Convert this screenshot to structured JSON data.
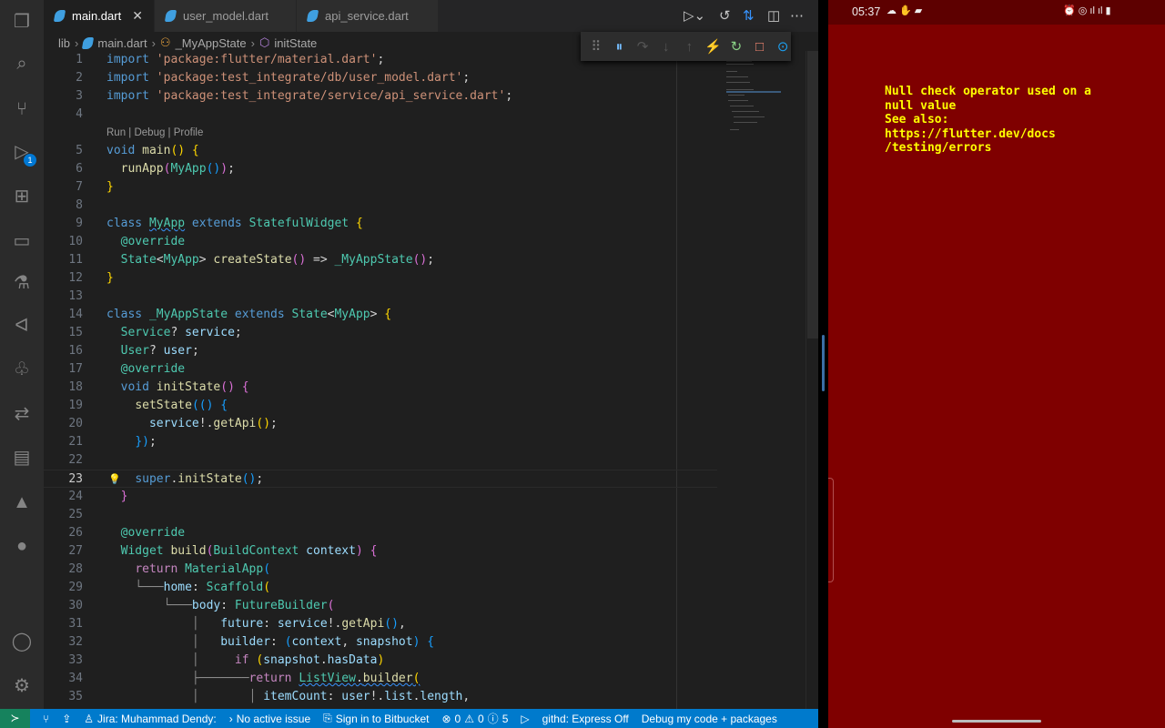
{
  "tabs": [
    {
      "label": "main.dart",
      "active": true
    },
    {
      "label": "user_model.dart"
    },
    {
      "label": "api_service.dart"
    }
  ],
  "breadcrumb": [
    "lib",
    "main.dart",
    "_MyAppState",
    "initState"
  ],
  "activity_badge": "1",
  "codelens": "Run | Debug | Profile",
  "current_line": 23,
  "code": [
    [
      1,
      [
        [
          "kw",
          "import "
        ],
        [
          "st",
          "'package:flutter/material.dart'"
        ],
        [
          "pu",
          ";"
        ]
      ]
    ],
    [
      2,
      [
        [
          "kw",
          "import "
        ],
        [
          "st",
          "'package:test_integrate/db/user_model.dart'"
        ],
        [
          "pu",
          ";"
        ]
      ]
    ],
    [
      3,
      [
        [
          "kw",
          "import "
        ],
        [
          "st",
          "'package:test_integrate/service/api_service.dart'"
        ],
        [
          "pu",
          ";"
        ]
      ]
    ],
    [
      4,
      []
    ],
    [
      "lens"
    ],
    [
      5,
      [
        [
          "kw",
          "void "
        ],
        [
          "fn",
          "main"
        ],
        [
          "b1",
          "() {"
        ]
      ]
    ],
    [
      6,
      [
        [
          "pu",
          "  "
        ],
        [
          "fn",
          "runApp"
        ],
        [
          "b2",
          "("
        ],
        [
          "ty",
          "MyApp"
        ],
        [
          "b3",
          "()"
        ],
        [
          "b2",
          ")"
        ],
        [
          "pu",
          ";"
        ]
      ]
    ],
    [
      7,
      [
        [
          "b1",
          "}"
        ]
      ]
    ],
    [
      8,
      []
    ],
    [
      9,
      [
        [
          "kw",
          "class "
        ],
        [
          "ty",
          "MyApp"
        ],
        [
          "kw",
          " extends "
        ],
        [
          "ty",
          "StatefulWidget "
        ],
        [
          "b1",
          "{"
        ]
      ]
    ],
    [
      10,
      [
        [
          "pu",
          "  "
        ],
        [
          "ty",
          "@override"
        ]
      ]
    ],
    [
      11,
      [
        [
          "pu",
          "  "
        ],
        [
          "ty",
          "State"
        ],
        [
          "pu",
          "<"
        ],
        [
          "ty",
          "MyApp"
        ],
        [
          "pu",
          "> "
        ],
        [
          "fn",
          "createState"
        ],
        [
          "b2",
          "()"
        ],
        [
          "pu",
          " => "
        ],
        [
          "ty",
          "_MyAppState"
        ],
        [
          "b2",
          "()"
        ],
        [
          "pu",
          ";"
        ]
      ]
    ],
    [
      12,
      [
        [
          "b1",
          "}"
        ]
      ]
    ],
    [
      13,
      []
    ],
    [
      14,
      [
        [
          "kw",
          "class "
        ],
        [
          "ty",
          "_MyAppState"
        ],
        [
          "kw",
          " extends "
        ],
        [
          "ty",
          "State"
        ],
        [
          "pu",
          "<"
        ],
        [
          "ty",
          "MyApp"
        ],
        [
          "pu",
          "> "
        ],
        [
          "b1",
          "{"
        ]
      ]
    ],
    [
      15,
      [
        [
          "pu",
          "  "
        ],
        [
          "ty",
          "Service"
        ],
        [
          "pu",
          "? "
        ],
        [
          "va",
          "service"
        ],
        [
          "pu",
          ";"
        ]
      ]
    ],
    [
      16,
      [
        [
          "pu",
          "  "
        ],
        [
          "ty",
          "User"
        ],
        [
          "pu",
          "? "
        ],
        [
          "va",
          "user"
        ],
        [
          "pu",
          ";"
        ]
      ]
    ],
    [
      17,
      [
        [
          "pu",
          "  "
        ],
        [
          "ty",
          "@override"
        ]
      ]
    ],
    [
      18,
      [
        [
          "pu",
          "  "
        ],
        [
          "kw",
          "void "
        ],
        [
          "fn",
          "initState"
        ],
        [
          "b2",
          "() {"
        ]
      ]
    ],
    [
      19,
      [
        [
          "pu",
          "    "
        ],
        [
          "fn",
          "setState"
        ],
        [
          "b3",
          "(() {"
        ]
      ]
    ],
    [
      20,
      [
        [
          "pu",
          "      "
        ],
        [
          "va",
          "service"
        ],
        [
          "pu",
          "!."
        ],
        [
          "fn",
          "getApi"
        ],
        [
          "b1",
          "()"
        ],
        [
          "pu",
          ";"
        ]
      ]
    ],
    [
      21,
      [
        [
          "pu",
          "    "
        ],
        [
          "b3",
          "})"
        ],
        [
          "pu",
          ";"
        ]
      ]
    ],
    [
      22,
      []
    ],
    [
      23,
      [
        [
          "pu",
          "    "
        ],
        [
          "kw",
          "super"
        ],
        [
          "pu",
          "."
        ],
        [
          "fn",
          "initState"
        ],
        [
          "b3",
          "()"
        ],
        [
          "pu",
          ";"
        ]
      ]
    ],
    [
      24,
      [
        [
          "pu",
          "  "
        ],
        [
          "b2",
          "}"
        ]
      ]
    ],
    [
      25,
      []
    ],
    [
      26,
      [
        [
          "pu",
          "  "
        ],
        [
          "ty",
          "@override"
        ]
      ]
    ],
    [
      27,
      [
        [
          "pu",
          "  "
        ],
        [
          "ty",
          "Widget "
        ],
        [
          "fn",
          "build"
        ],
        [
          "b2",
          "("
        ],
        [
          "ty",
          "BuildContext "
        ],
        [
          "va",
          "context"
        ],
        [
          "b2",
          ")"
        ],
        [
          "pu",
          " "
        ],
        [
          "b2",
          "{"
        ]
      ]
    ],
    [
      28,
      [
        [
          "pu",
          "    "
        ],
        [
          "ct",
          "return "
        ],
        [
          "ty",
          "MaterialApp"
        ],
        [
          "b3",
          "("
        ]
      ]
    ],
    [
      29,
      [
        [
          "gd",
          "    └───"
        ],
        [
          "va",
          "home"
        ],
        [
          "pu",
          ": "
        ],
        [
          "ty",
          "Scaffold"
        ],
        [
          "b1",
          "("
        ]
      ]
    ],
    [
      30,
      [
        [
          "gd",
          "        └───"
        ],
        [
          "va",
          "body"
        ],
        [
          "pu",
          ": "
        ],
        [
          "ty",
          "FutureBuilder"
        ],
        [
          "b2",
          "("
        ]
      ]
    ],
    [
      31,
      [
        [
          "gd",
          "            │   "
        ],
        [
          "va",
          "future"
        ],
        [
          "pu",
          ": "
        ],
        [
          "va",
          "service"
        ],
        [
          "pu",
          "!."
        ],
        [
          "fn",
          "getApi"
        ],
        [
          "b3",
          "()"
        ],
        [
          "pu",
          ","
        ]
      ]
    ],
    [
      32,
      [
        [
          "gd",
          "            │   "
        ],
        [
          "va",
          "builder"
        ],
        [
          "pu",
          ": "
        ],
        [
          "b3",
          "("
        ],
        [
          "va",
          "context"
        ],
        [
          "pu",
          ", "
        ],
        [
          "va",
          "snapshot"
        ],
        [
          "b3",
          ")"
        ],
        [
          "pu",
          " "
        ],
        [
          "b3",
          "{"
        ]
      ]
    ],
    [
      33,
      [
        [
          "gd",
          "            │     "
        ],
        [
          "ct",
          "if "
        ],
        [
          "b1",
          "("
        ],
        [
          "va",
          "snapshot"
        ],
        [
          "pu",
          "."
        ],
        [
          "va",
          "hasData"
        ],
        [
          "b1",
          ")"
        ]
      ]
    ],
    [
      34,
      [
        [
          "gd",
          "            ├───────"
        ],
        [
          "ct",
          "return "
        ],
        [
          "ty",
          "ListView"
        ],
        [
          "pu",
          "."
        ],
        [
          "fn",
          "builder"
        ],
        [
          "b1",
          "("
        ]
      ]
    ],
    [
      35,
      [
        [
          "gd",
          "            │       │ "
        ],
        [
          "va",
          "itemCount"
        ],
        [
          "pu",
          ": "
        ],
        [
          "va",
          "user"
        ],
        [
          "pu",
          "!."
        ],
        [
          "va",
          "list"
        ],
        [
          "pu",
          "."
        ],
        [
          "va",
          "length"
        ],
        [
          "pu",
          ","
        ]
      ]
    ]
  ],
  "statusbar": {
    "jira": "Jira: Muhammad Dendy:",
    "issue": "No active issue",
    "bitbucket": "Sign in to Bitbucket",
    "errors": "0",
    "warnings": "0",
    "info": "5",
    "githd": "githd: Express Off",
    "debug": "Debug my code + packages"
  },
  "phone": {
    "time": "05:37",
    "error": "Null check operator used on a\nnull value\nSee also:\nhttps://flutter.dev/docs\n/testing/errors",
    "background": "#7f0000",
    "error_color": "#ffff00"
  },
  "colors": {
    "accent": "#007acc",
    "remote": "#16825d"
  }
}
